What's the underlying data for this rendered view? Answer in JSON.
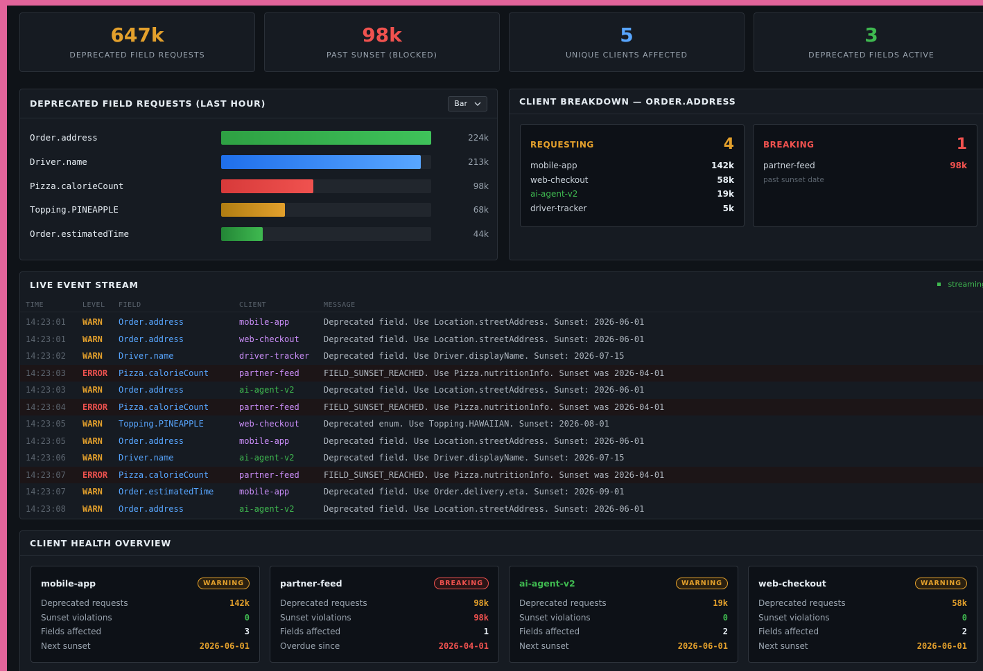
{
  "colors": {
    "orange": "#e3a02c",
    "red": "#f0524f",
    "blue": "#58a6ff",
    "green": "#3fb950",
    "purple": "#c98df7"
  },
  "kpis": [
    {
      "value": "647k",
      "label": "DEPRECATED FIELD REQUESTS",
      "color": "#e3a02c"
    },
    {
      "value": "98k",
      "label": "PAST SUNSET (BLOCKED)",
      "color": "#f0524f"
    },
    {
      "value": "5",
      "label": "UNIQUE CLIENTS AFFECTED",
      "color": "#58a6ff"
    },
    {
      "value": "3",
      "label": "DEPRECATED FIELDS ACTIVE",
      "color": "#3fb950"
    }
  ],
  "requests_panel": {
    "title": "DEPRECATED FIELD REQUESTS (LAST HOUR)",
    "select_value": "Bar"
  },
  "chart_data": {
    "type": "bar",
    "orientation": "horizontal",
    "categories": [
      "Order.address",
      "Driver.name",
      "Pizza.calorieCount",
      "Topping.PINEAPPLE",
      "Order.estimatedTime"
    ],
    "values": [
      224,
      213,
      98,
      68,
      44
    ],
    "value_labels": [
      "224k",
      "213k",
      "98k",
      "68k",
      "44k"
    ],
    "bar_colors": [
      [
        "#2ea043",
        "#3fc25a"
      ],
      [
        "#1f6feb",
        "#58a6ff"
      ],
      [
        "#d73a3a",
        "#f0524f"
      ],
      [
        "#b07d12",
        "#e3a02c"
      ],
      [
        "#238636",
        "#3fb950"
      ]
    ],
    "max": 224
  },
  "breakdown": {
    "title": "CLIENT BREAKDOWN — ORDER.ADDRESS",
    "requesting": {
      "label": "REQUESTING",
      "count": "4",
      "items": [
        {
          "name": "mobile-app",
          "value": "142k"
        },
        {
          "name": "web-checkout",
          "value": "58k"
        },
        {
          "name": "ai-agent-v2",
          "value": "19k"
        },
        {
          "name": "driver-tracker",
          "value": "5k"
        }
      ]
    },
    "breaking": {
      "label": "BREAKING",
      "count": "1",
      "items": [
        {
          "name": "partner-feed",
          "value": "98k"
        }
      ],
      "note": "past sunset date"
    }
  },
  "stream": {
    "title": "LIVE EVENT STREAM",
    "status": "streaming",
    "columns": [
      "TIME",
      "LEVEL",
      "FIELD",
      "CLIENT",
      "MESSAGE"
    ],
    "rows": [
      {
        "time": "14:23:01",
        "level": "WARN",
        "field": "Order.address",
        "client": "mobile-app",
        "message": "Deprecated field. Use Location.streetAddress. Sunset: 2026-06-01"
      },
      {
        "time": "14:23:01",
        "level": "WARN",
        "field": "Order.address",
        "client": "web-checkout",
        "message": "Deprecated field. Use Location.streetAddress. Sunset: 2026-06-01"
      },
      {
        "time": "14:23:02",
        "level": "WARN",
        "field": "Driver.name",
        "client": "driver-tracker",
        "message": "Deprecated field. Use Driver.displayName. Sunset: 2026-07-15"
      },
      {
        "time": "14:23:03",
        "level": "ERROR",
        "field": "Pizza.calorieCount",
        "client": "partner-feed",
        "message": "FIELD_SUNSET_REACHED. Use Pizza.nutritionInfo. Sunset was 2026-04-01"
      },
      {
        "time": "14:23:03",
        "level": "WARN",
        "field": "Order.address",
        "client": "ai-agent-v2",
        "message": "Deprecated field. Use Location.streetAddress. Sunset: 2026-06-01"
      },
      {
        "time": "14:23:04",
        "level": "ERROR",
        "field": "Pizza.calorieCount",
        "client": "partner-feed",
        "message": "FIELD_SUNSET_REACHED. Use Pizza.nutritionInfo. Sunset was 2026-04-01"
      },
      {
        "time": "14:23:05",
        "level": "WARN",
        "field": "Topping.PINEAPPLE",
        "client": "web-checkout",
        "message": "Deprecated enum. Use Topping.HAWAIIAN. Sunset: 2026-08-01"
      },
      {
        "time": "14:23:05",
        "level": "WARN",
        "field": "Order.address",
        "client": "mobile-app",
        "message": "Deprecated field. Use Location.streetAddress. Sunset: 2026-06-01"
      },
      {
        "time": "14:23:06",
        "level": "WARN",
        "field": "Driver.name",
        "client": "ai-agent-v2",
        "message": "Deprecated field. Use Driver.displayName. Sunset: 2026-07-15"
      },
      {
        "time": "14:23:07",
        "level": "ERROR",
        "field": "Pizza.calorieCount",
        "client": "partner-feed",
        "message": "FIELD_SUNSET_REACHED. Use Pizza.nutritionInfo. Sunset was 2026-04-01"
      },
      {
        "time": "14:23:07",
        "level": "WARN",
        "field": "Order.estimatedTime",
        "client": "mobile-app",
        "message": "Deprecated field. Use Order.delivery.eta. Sunset: 2026-09-01"
      },
      {
        "time": "14:23:08",
        "level": "WARN",
        "field": "Order.address",
        "client": "ai-agent-v2",
        "message": "Deprecated field. Use Location.streetAddress. Sunset: 2026-06-01"
      }
    ]
  },
  "health": {
    "title": "CLIENT HEALTH OVERVIEW",
    "cards": [
      {
        "name": "mobile-app",
        "badge": "WARNING",
        "rows": [
          {
            "label": "Deprecated requests",
            "value": "142k",
            "tone": "orange"
          },
          {
            "label": "Sunset violations",
            "value": "0",
            "tone": "green"
          },
          {
            "label": "Fields affected",
            "value": "3",
            "tone": "white"
          },
          {
            "label": "Next sunset",
            "value": "2026-06-01",
            "tone": "orange"
          }
        ]
      },
      {
        "name": "partner-feed",
        "badge": "BREAKING",
        "rows": [
          {
            "label": "Deprecated requests",
            "value": "98k",
            "tone": "orange"
          },
          {
            "label": "Sunset violations",
            "value": "98k",
            "tone": "red"
          },
          {
            "label": "Fields affected",
            "value": "1",
            "tone": "white"
          },
          {
            "label": "Overdue since",
            "value": "2026-04-01",
            "tone": "red"
          }
        ]
      },
      {
        "name": "ai-agent-v2",
        "badge": "WARNING",
        "rows": [
          {
            "label": "Deprecated requests",
            "value": "19k",
            "tone": "orange"
          },
          {
            "label": "Sunset violations",
            "value": "0",
            "tone": "green"
          },
          {
            "label": "Fields affected",
            "value": "2",
            "tone": "white"
          },
          {
            "label": "Next sunset",
            "value": "2026-06-01",
            "tone": "orange"
          }
        ]
      },
      {
        "name": "web-checkout",
        "badge": "WARNING",
        "rows": [
          {
            "label": "Deprecated requests",
            "value": "58k",
            "tone": "orange"
          },
          {
            "label": "Sunset violations",
            "value": "0",
            "tone": "green"
          },
          {
            "label": "Fields affected",
            "value": "2",
            "tone": "white"
          },
          {
            "label": "Next sunset",
            "value": "2026-06-01",
            "tone": "orange"
          }
        ]
      }
    ]
  }
}
